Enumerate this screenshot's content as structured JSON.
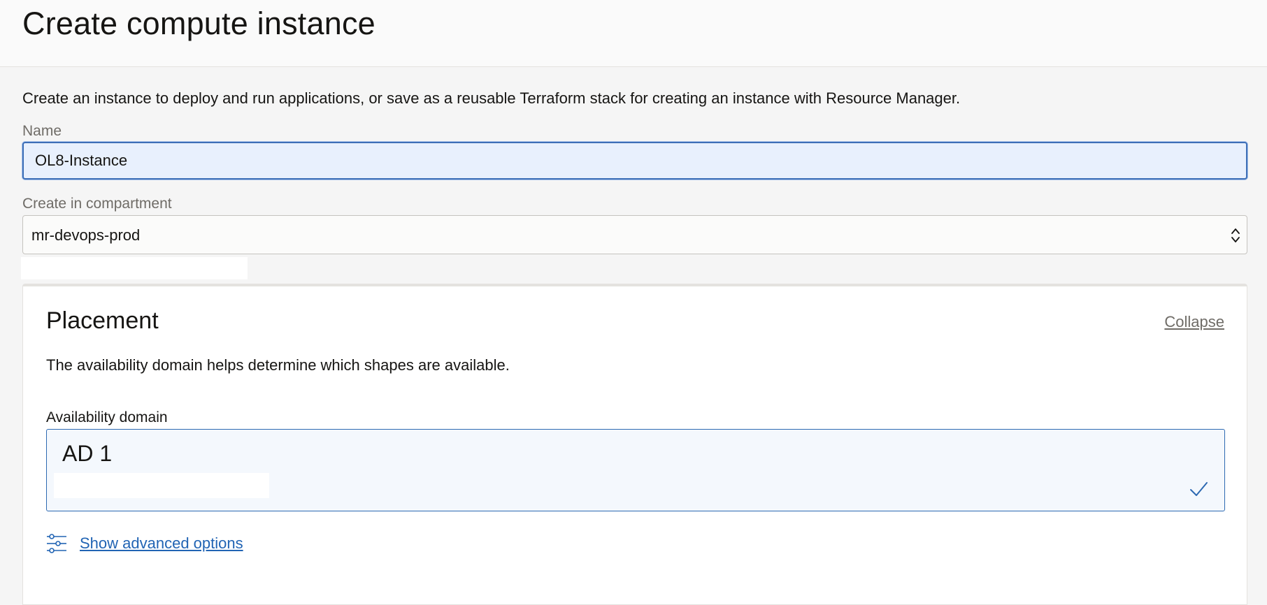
{
  "header": {
    "title": "Create compute instance"
  },
  "intro": "Create an instance to deploy and run applications, or save as a reusable Terraform stack for creating an instance with Resource Manager.",
  "form": {
    "name_label": "Name",
    "name_value": "OL8-Instance",
    "compartment_label": "Create in compartment",
    "compartment_value": "mr-devops-prod"
  },
  "placement": {
    "title": "Placement",
    "collapse_label": "Collapse",
    "description": "The availability domain helps determine which shapes are available.",
    "ad_label": "Availability domain",
    "ad_selected": "AD 1",
    "advanced_label": "Show advanced options"
  },
  "icons": {
    "compartment_select": "chevron-updown-icon",
    "ad_selected": "check-icon",
    "advanced": "sliders-icon"
  },
  "colors": {
    "accent": "#2164b4",
    "focus_border": "#3d6fb7",
    "input_focus_bg": "#e8f0fd",
    "selected_tile_bg": "#f4f8fd"
  }
}
